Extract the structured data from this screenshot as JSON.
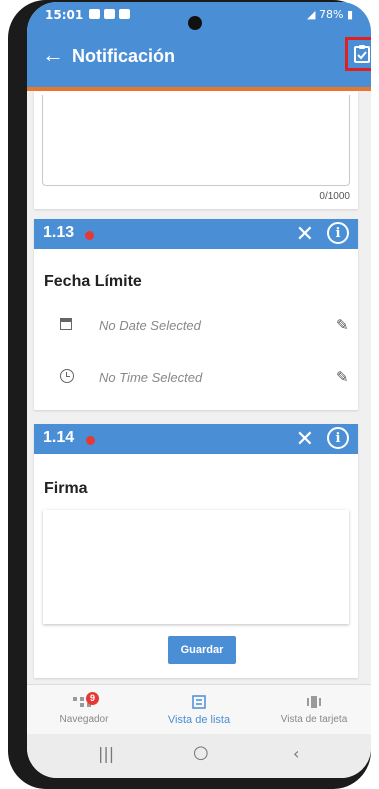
{
  "status_bar": {
    "time": "15:01",
    "battery": "78%"
  },
  "appbar": {
    "title": "Notificación",
    "back_icon": "arrow-left-icon",
    "action_icon": "clipboard-check-icon"
  },
  "text_field": {
    "char_count": "0/1000"
  },
  "questions": [
    {
      "number": "1.13",
      "title": "Fecha Límite",
      "date_placeholder": "No Date Selected",
      "time_placeholder": "No Time Selected"
    },
    {
      "number": "1.14",
      "title": "Firma",
      "save_label": "Guardar"
    }
  ],
  "bottom_nav": {
    "items": [
      {
        "label": "Navegador",
        "badge": "9",
        "active": false
      },
      {
        "label": "Vista de lista",
        "active": true
      },
      {
        "label": "Vista de tarjeta",
        "active": false
      }
    ]
  },
  "colors": {
    "primary": "#4a8fd6",
    "accent": "#e8772e",
    "required": "#e53935",
    "highlight": "#e0201f"
  }
}
